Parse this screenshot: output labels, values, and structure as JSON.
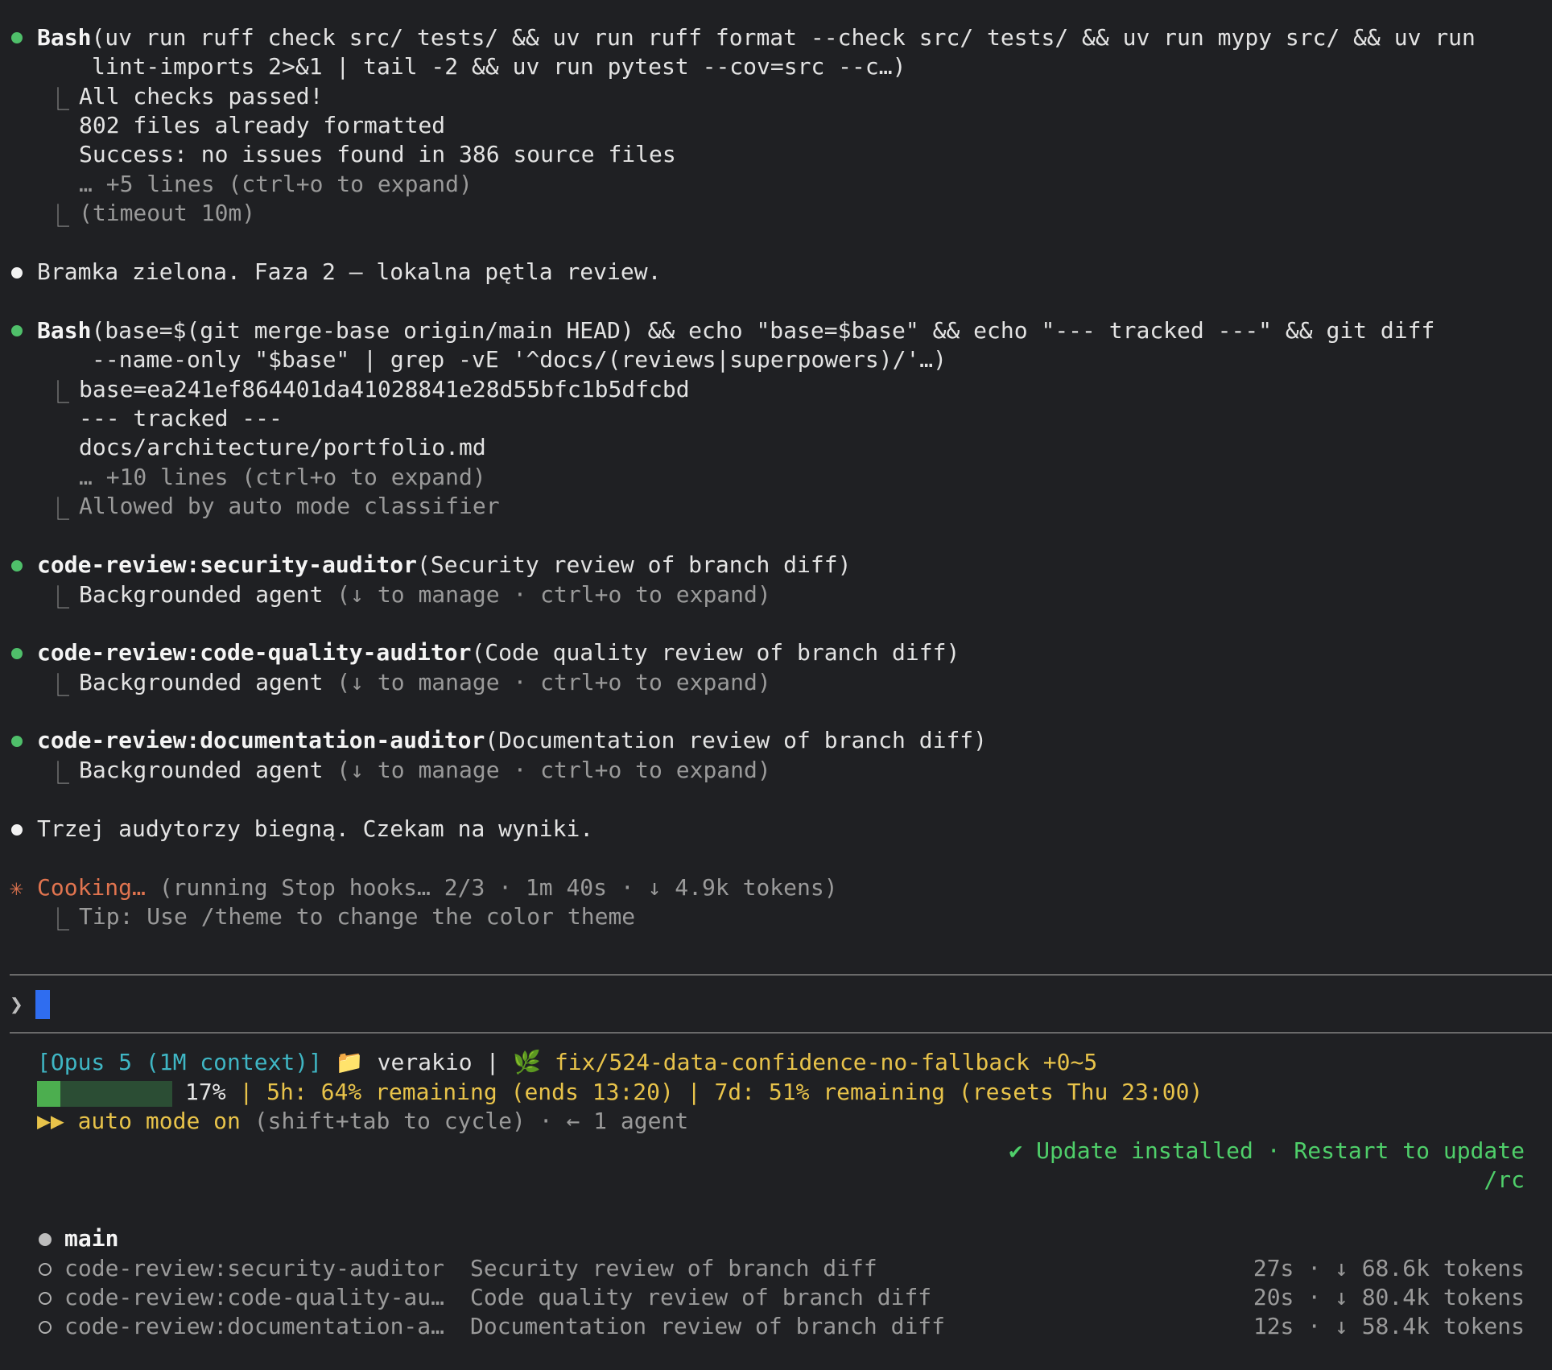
{
  "blocks": {
    "bash1": {
      "tool": "Bash",
      "args_line1": "(uv run ruff check src/ tests/ && uv run ruff format --check src/ tests/ && uv run mypy src/ && uv run",
      "args_line2": "lint-imports 2>&1 | tail -2 && uv run pytest --cov=src --c…)",
      "out1": "All checks passed!",
      "out2": "802 files already formatted",
      "out3": "Success: no issues found in 386 source files",
      "expand": "… +5 lines (ctrl+o to expand)",
      "timeout": "(timeout 10m)"
    },
    "msg1": "Bramka zielona. Faza 2 — lokalna pętla review.",
    "bash2": {
      "tool": "Bash",
      "args_line1": "(base=$(git merge-base origin/main HEAD) && echo \"base=$base\" && echo \"--- tracked ---\" && git diff",
      "args_line2": "--name-only \"$base\" | grep -vE '^docs/(reviews|superpowers)/'…)",
      "out1": "base=ea241ef864401da41028841e28d55bfc1b5dfcbd",
      "out2": "--- tracked ---",
      "out3": "docs/architecture/portfolio.md",
      "expand": "… +10 lines (ctrl+o to expand)",
      "allowed": "Allowed by auto mode classifier"
    },
    "agent1": {
      "name": "code-review:security-auditor",
      "args": "(Security review of branch diff)",
      "status": "Backgrounded agent",
      "hint": "(↓ to manage · ctrl+o to expand)"
    },
    "agent2": {
      "name": "code-review:code-quality-auditor",
      "args": "(Code quality review of branch diff)",
      "status": "Backgrounded agent",
      "hint": "(↓ to manage · ctrl+o to expand)"
    },
    "agent3": {
      "name": "code-review:documentation-auditor",
      "args": "(Documentation review of branch diff)",
      "status": "Backgrounded agent",
      "hint": "(↓ to manage · ctrl+o to expand)"
    },
    "msg2": "Trzej audytorzy biegną. Czekam na wyniki.",
    "cooking": {
      "star": "✳",
      "label": "Cooking…",
      "detail": "(running Stop hooks… 2/3 · 1m 40s · ↓ 4.9k tokens)",
      "tip": "Tip: Use /theme to change the color theme"
    }
  },
  "prompt": {
    "caret": "❯"
  },
  "status": {
    "model": "[Opus 5 (1M context)]",
    "folder_icon": "folder-icon",
    "folder": "verakio",
    "sep": "|",
    "branch_icon": "leaf-icon",
    "branch": "fix/524-data-confidence-no-fallback +0~5",
    "context_pct_value": 0.17,
    "context_pct": "17%",
    "limits": "| 5h: 64% remaining (ends 13:20) | 7d: 51% remaining (resets Thu 23:00)",
    "mode_arrows": "▶▶",
    "mode": "auto mode on",
    "mode_hint": "(shift+tab to cycle) · ← 1 agent",
    "update": "✔ Update installed · Restart to update",
    "rc": "/rc"
  },
  "agents": {
    "main": "main",
    "rows": [
      {
        "name": "code-review:security-auditor",
        "desc": "Security review of branch diff",
        "stats": "27s · ↓ 68.6k tokens"
      },
      {
        "name": "code-review:code-quality-au…",
        "desc": "Code quality review of branch diff",
        "stats": "20s · ↓ 80.4k tokens"
      },
      {
        "name": "code-review:documentation-a…",
        "desc": "Documentation review of branch diff",
        "stats": "12s · ↓ 58.4k tokens"
      }
    ]
  },
  "colors": {
    "background": "#1f2023",
    "green_bullet": "#4fbf6a",
    "orange": "#e0744f",
    "cyan": "#3fb6c4",
    "yellow": "#e8c34a",
    "cursor": "#2f6df0"
  }
}
